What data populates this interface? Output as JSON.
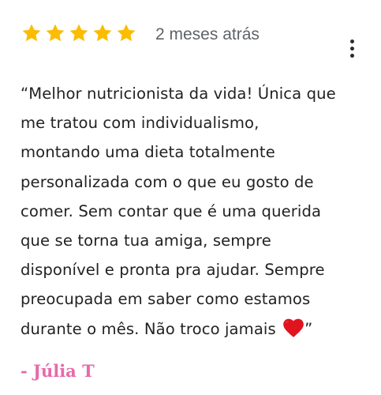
{
  "review": {
    "rating": 5,
    "rating_max": 5,
    "star_color": "#fbbc04",
    "time_ago": "2 meses atrás",
    "menu_icon": "more-vert-icon",
    "text": "“Melhor nutricionista da vida! Única que\nme tratou com individualismo,\nmontando uma dieta totalmente\npersonalizada com o que eu gosto de\ncomer. Sem contar que é uma querida\nque se torna tua amiga, sempre\ndisponível e pronta pra ajudar. Sempre\npreocupada em saber como estamos\ndurante o mês. Não troco jamais",
    "emoji": "red-heart-icon",
    "closing_quote": "”",
    "author": "- Júlia T",
    "author_color": "#e66aa8"
  }
}
